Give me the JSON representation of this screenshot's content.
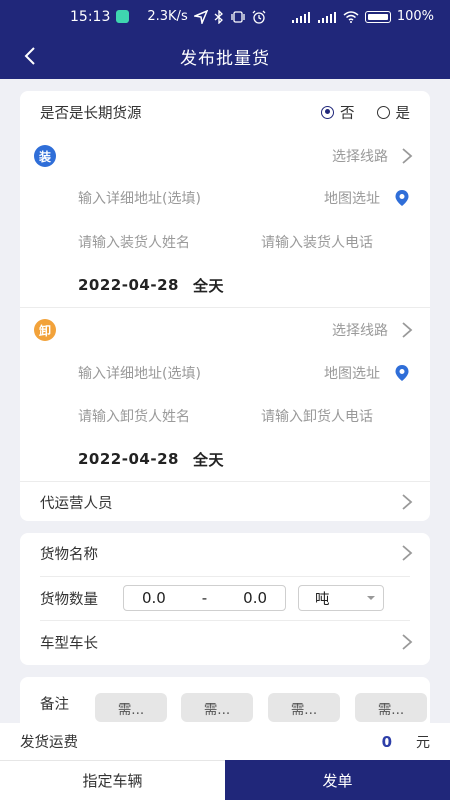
{
  "status_bar": {
    "time": "15:13",
    "speed": "2.3K/s",
    "battery": "100%"
  },
  "nav": {
    "title": "发布批量货"
  },
  "long_term": {
    "label": "是否是长期货源",
    "option_no": "否",
    "option_yes": "是",
    "selected": "否"
  },
  "loading": {
    "badge": "装",
    "route_hint": "选择线路",
    "address_placeholder": "输入详细地址(选填)",
    "map_select": "地图选址",
    "name_placeholder": "请输入装货人姓名",
    "phone_placeholder": "请输入装货人电话",
    "date": "2022-04-28",
    "time_range": "全天"
  },
  "unloading": {
    "badge": "卸",
    "route_hint": "选择线路",
    "address_placeholder": "输入详细地址(选填)",
    "map_select": "地图选址",
    "name_placeholder": "请输入卸货人姓名",
    "phone_placeholder": "请输入卸货人电话",
    "date": "2022-04-28",
    "time_range": "全天"
  },
  "agent": {
    "label": "代运营人员"
  },
  "goods": {
    "name_label": "货物名称",
    "qty_label": "货物数量",
    "qty_min": "0.0",
    "qty_sep": "-",
    "qty_max": "0.0",
    "unit": "吨",
    "vehicle_label": "车型车长"
  },
  "remarks": {
    "label": "备注",
    "chips": [
      "需...",
      "需...",
      "需...",
      "需..."
    ]
  },
  "fee": {
    "label": "发货运费",
    "value": "0",
    "unit": "元"
  },
  "bottom": {
    "left_label": "指定车辆",
    "right_label": "发单"
  },
  "colors": {
    "primary": "#20277a",
    "load_badge": "#2f6ed8",
    "unload_badge": "#f2a23a",
    "map_pin": "#2f6ed8"
  }
}
